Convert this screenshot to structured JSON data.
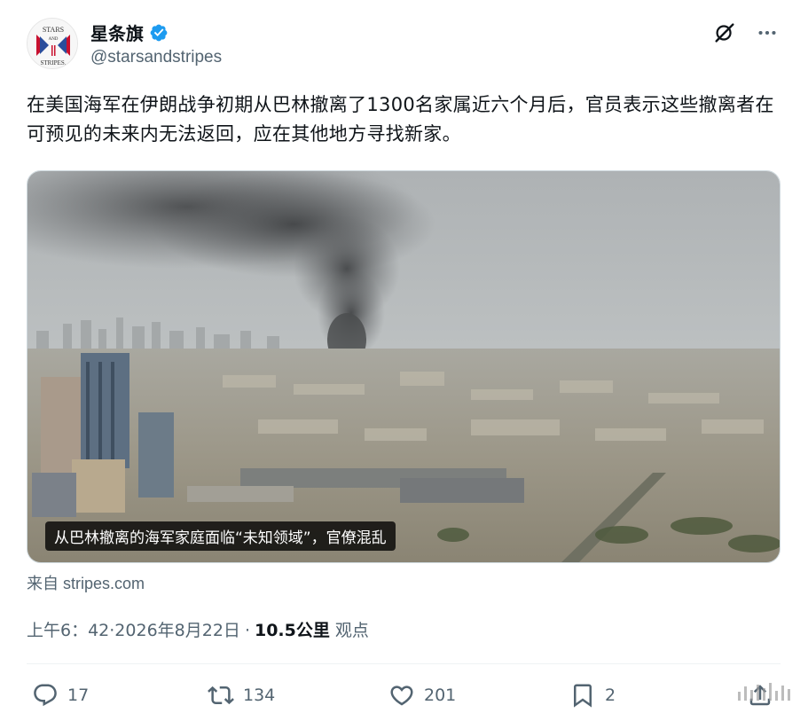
{
  "account": {
    "avatar_text_top": "STARS",
    "avatar_text_mid": "AND",
    "avatar_text_bottom": "STRIPES.",
    "display_name": "星条旗",
    "handle": "@starsandstripes",
    "verified_color": "#1d9bf0"
  },
  "header_actions": {
    "grok_icon": "grok-icon",
    "more_icon": "more-icon"
  },
  "tweet": {
    "text": "在美国海军在伊朗战争初期从巴林撤离了1300名家属近六个月后，官员表示这些撤离者在可预见的未来内无法返回，应在其他地方寻找新家。",
    "media_caption": "从巴林撤离的海军家庭面临“未知领域”，官僚混乱",
    "source_prefix": "来自",
    "source_domain": "stripes.com"
  },
  "meta": {
    "time": "上午6：42",
    "date": "·2026年8月22日",
    "dot": "·",
    "views_count": "10.5公里",
    "views_label": "观点"
  },
  "actions": {
    "replies": "17",
    "reposts": "134",
    "likes": "201",
    "bookmarks": "2"
  },
  "colors": {
    "text_primary": "#0f1419",
    "text_secondary": "#536471",
    "divider": "#eff3f4"
  }
}
